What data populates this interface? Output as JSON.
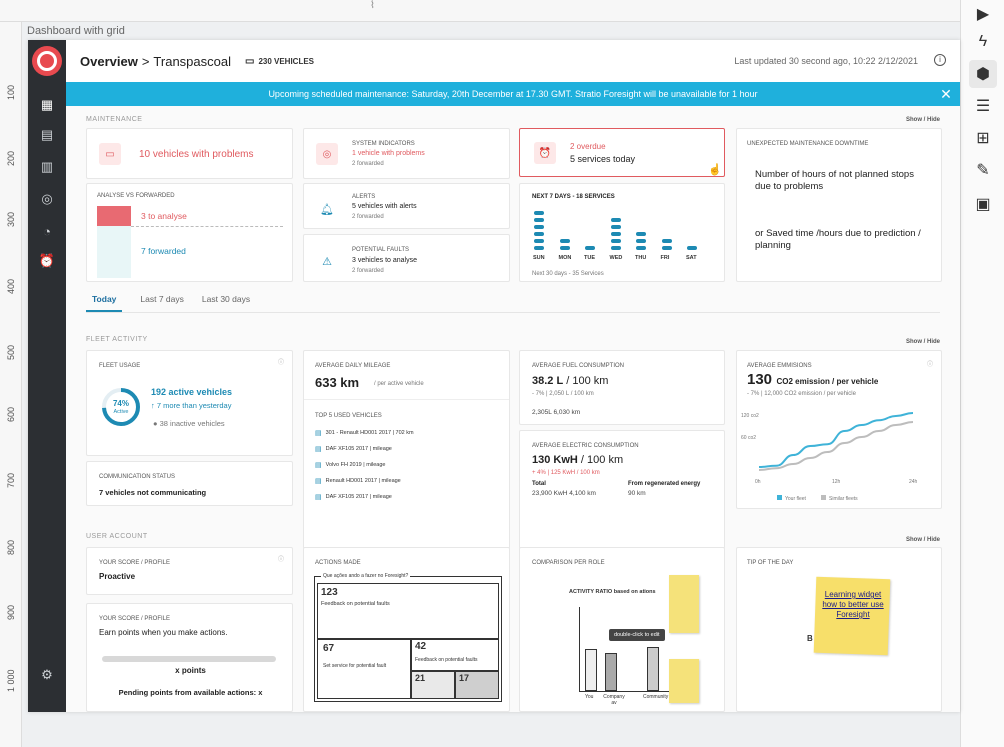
{
  "artboard_label": "Dashboard with grid",
  "ruler_ticks": [
    "100",
    "200",
    "300",
    "400",
    "500",
    "600",
    "700",
    "800",
    "900",
    "1 000"
  ],
  "header": {
    "title": "Overview",
    "separator": ">",
    "subtitle": "Transpascoal",
    "vehicles": "230 VEHICLES",
    "updated": "Last updated 30 second ago, 10:22 2/12/2021",
    "info_icon": "i"
  },
  "banner": {
    "text": "Upcoming scheduled maintenance: Saturday, 20th December at 17.30 GMT. Stratio Foresight will be unavailable for 1 hour",
    "close": "✕"
  },
  "maintenance": {
    "title": "MAINTENANCE",
    "show_hide": "Show / Hide",
    "problems": "10 vehicles with problems",
    "system_label": "SYSTEM INDICATORS",
    "system_value": "1 vehicle with problems",
    "system_sub": "2 forwarded",
    "overdue": "2 overdue",
    "services_today": "5 services today",
    "unexpected_label": "UNEXPECTED MAINTENANCE DOWNTIME",
    "unexpected_text1": "Number of hours of not planned stops due to problems",
    "unexpected_text2": "or Saved time /hours due to prediction / planning",
    "analyse_label": "ANALYSE VS FORWARDED",
    "to_analyse": "3 to analyse",
    "forwarded": "7 forwarded",
    "alerts_label": "ALERTS",
    "alerts_value": "5 vehicles with alerts",
    "alerts_sub": "2 forwarded",
    "faults_label": "POTENTIAL FAULTS",
    "faults_value": "3 vehicles to analyse",
    "faults_sub": "2 forwarded",
    "next7_label": "NEXT 7 DAYS - 18 SERVICES",
    "next30": "Next 30 days - 35 Services",
    "days": [
      "SUN",
      "MON",
      "TUE",
      "WED",
      "THU",
      "FRI",
      "SAT"
    ],
    "day_counts": [
      6,
      2,
      1,
      5,
      3,
      2,
      1
    ]
  },
  "tabs": [
    "Today",
    "Last 7 days",
    "Last 30 days"
  ],
  "fleet": {
    "title": "FLEET ACTIVITY",
    "show_hide": "Show / Hide",
    "usage_label": "FLEET USAGE",
    "usage_pct": "74%",
    "usage_pct_value": 0.74,
    "usage_active": "Active",
    "active_vehicles": "192 active vehicles",
    "more_than": "7 more than yesterday",
    "inactive": "38 inactive vehicles",
    "comm_label": "COMMUNICATION STATUS",
    "comm_value": "7 vehicles not communicating",
    "mileage_label": "AVERAGE DAILY MILEAGE",
    "mileage_value": "633 km",
    "mileage_unit": "/ per active vehicle",
    "top5_label": "TOP 5 USED VEHICLES",
    "top5": [
      "301 - Renault HD001 2017 | 702 km",
      "DAF XF105 2017 | mileage",
      "Volvo FH 2019 | mileage",
      "Renault HD001 2017 | mileage",
      "DAF XF105 2017 | mileage"
    ],
    "fuel_label": "AVERAGE FUEL CONSUMPTION",
    "fuel_value": "38.2 L",
    "fuel_unit": "/ 100 km",
    "fuel_delta": "- 7% | 2,050 L / 100 km",
    "fuel_totals": "2,305L  6,030 km",
    "elec_label": "AVERAGE ELECTRIC CONSUMPTION",
    "elec_value": "130 KwH",
    "elec_unit": "/ 100 km",
    "elec_delta": "+ 4% | 125 KwH / 100 km",
    "elec_total_label": "Total",
    "elec_regen_label": "From regenerated energy",
    "elec_total": "23,900 KwH  4,100 km",
    "elec_regen": "90 km",
    "emis_label": "AVERAGE EMMISIONS",
    "emis_value": "130",
    "emis_unit": "CO2 emission / per vehicle",
    "emis_delta": "- 7% | 12,000 CO2 emission / per vehicle"
  },
  "chart_data": {
    "type": "line",
    "x": [
      "0h",
      "12h",
      "24h"
    ],
    "yticks": [
      "120 co2",
      "60 co2"
    ],
    "series": [
      {
        "name": "Your fleet",
        "values": [
          10,
          12,
          30,
          45,
          48,
          70,
          80,
          88,
          95,
          100
        ]
      },
      {
        "name": "Similar fleets",
        "values": [
          5,
          8,
          15,
          25,
          35,
          50,
          60,
          70,
          80,
          85
        ]
      }
    ],
    "colors": [
      "#3fb3d8",
      "#bdbdbd"
    ]
  },
  "user": {
    "title": "USER ACCOUNT",
    "show_hide": "Show / Hide",
    "score_label": "YOUR SCORE / PROFILE",
    "score_value": "Proactive",
    "score2_label": "YOUR SCORE / PROFILE",
    "earn": "Earn points when you make actions.",
    "x_points": "x points",
    "pending": "Pending points from available actions: x",
    "actions_label": "ACTIONS MADE",
    "actions_q": "Que ações ando a fazer no Foresight?",
    "a123": "123",
    "a123_t": "Feedback on potential faults",
    "a67": "67",
    "a67_t": "Set service for potential fault",
    "a42": "42",
    "a42_t": "Feedback on potential faults",
    "a21": "21",
    "a17": "17",
    "compare_label": "COMPARISON PER ROLE",
    "compare_title": "ACTIVITY RATIO based on ations",
    "dbl_click": "double-click to edit",
    "compare_x": [
      "You",
      "Company av",
      "Community"
    ],
    "tip_label": "TIP OF THE DAY",
    "tip_text": "Learning widget how to better use Foresight"
  }
}
